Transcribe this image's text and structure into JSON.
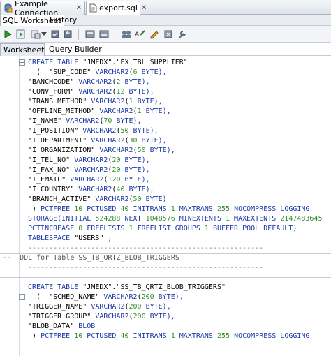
{
  "tabs": [
    {
      "label": "Example Connection",
      "icon": "database-connection-icon"
    },
    {
      "label": "export.sql",
      "icon": "sql-file-icon"
    }
  ],
  "subtabs": {
    "worksheet": "SQL Worksheet",
    "history": "History"
  },
  "worksheet_tabs": {
    "worksheet": "Worksheet",
    "query_builder": "Query Builder"
  },
  "toolbar": [
    "run-statement-icon",
    "run-script-icon",
    "explain-plan-icon",
    "dropdown-arrow-icon",
    "commit-icon",
    "rollback-icon",
    "autotrace-icon",
    "format-icon",
    "uppercase-icon",
    "clear-icon",
    "sql-tuning-icon"
  ],
  "code": {
    "l1": [
      "CREATE TABLE ",
      "\"JMEDX\".\"EX_TBL_SUPPLIER\""
    ],
    "l2": [
      "  (  \"SUP_CODE\" ",
      "VARCHAR2",
      "(",
      "6",
      " BYTE),"
    ],
    "l3": [
      "\"BANCHCODE\" ",
      "VARCHAR2",
      "(",
      "2",
      " BYTE),"
    ],
    "l4": [
      "\"CONV_FORM\" ",
      "VARCHAR2",
      "(",
      "12",
      " BYTE),"
    ],
    "l5": [
      "\"TRANS_METHOD\" ",
      "VARCHAR2",
      "(",
      "1",
      " BYTE),"
    ],
    "l6": [
      "\"OFFLINE_METHOD\" ",
      "VARCHAR2",
      "(",
      "1",
      " BYTE),"
    ],
    "l7": [
      "\"I_NAME\" ",
      "VARCHAR2",
      "(",
      "70",
      " BYTE),"
    ],
    "l8": [
      "\"I_POSITION\" ",
      "VARCHAR2",
      "(",
      "50",
      " BYTE),"
    ],
    "l9": [
      "\"I_DEPARTMENT\" ",
      "VARCHAR2",
      "(",
      "30",
      " BYTE),"
    ],
    "l10": [
      "\"I_ORGANIZATION\" ",
      "VARCHAR2",
      "(",
      "50",
      " BYTE),"
    ],
    "l11": [
      "\"I_TEL_NO\" ",
      "VARCHAR2",
      "(",
      "20",
      " BYTE),"
    ],
    "l12": [
      "\"I_FAX_NO\" ",
      "VARCHAR2",
      "(",
      "20",
      " BYTE),"
    ],
    "l13": [
      "\"I_EMAIL\" ",
      "VARCHAR2",
      "(",
      "120",
      " BYTE),"
    ],
    "l14": [
      "\"I_COUNTRY\" ",
      "VARCHAR2",
      "(",
      "40",
      " BYTE),"
    ],
    "l15": [
      "\"BRANCH_ACTIVE\" ",
      "VARCHAR2",
      "(",
      "50",
      " BYTE)"
    ],
    "l16": [
      " ) ",
      "PCTFREE ",
      "10",
      " PCTUSED ",
      "40",
      " INITRANS ",
      "1",
      " MAXTRANS ",
      "255",
      " NOCOMPRESS LOGGING"
    ],
    "l17": [
      "STORAGE(INITIAL ",
      "524288",
      " NEXT ",
      "1048576",
      " MINEXTENTS ",
      "1",
      " MAXEXTENTS ",
      "2147483645"
    ],
    "l18": [
      "PCTINCREASE ",
      "0",
      " FREELISTS ",
      "1",
      " FREELIST GROUPS ",
      "1",
      " BUFFER_POOL DEFAULT)"
    ],
    "l19": [
      "TABLESPACE ",
      "\"USERS\" ;"
    ],
    "sep1": "--------------------------------------------------------",
    "comment": "--  DDL for Table SS_TB_QRTZ_BLOB_TRIGGERS",
    "sep2": "--------------------------------------------------------",
    "m1": [
      "CREATE TABLE ",
      "\"JMEDX\".\"SS_TB_QRTZ_BLOB_TRIGGERS\""
    ],
    "m2": [
      "  (  \"SCHED_NAME\" ",
      "VARCHAR2",
      "(",
      "200",
      " BYTE),"
    ],
    "m3": [
      "\"TRIGGER_NAME\" ",
      "VARCHAR2",
      "(",
      "200",
      " BYTE),"
    ],
    "m4": [
      "\"TRIGGER_GROUP\" ",
      "VARCHAR2",
      "(",
      "200",
      " BYTE),"
    ],
    "m5": [
      "\"BLOB_DATA\" ",
      "BLOB"
    ],
    "m6": [
      " ) ",
      "PCTFREE ",
      "10",
      " PCTUSED ",
      "40",
      " INITRANS ",
      "1",
      " MAXTRANS ",
      "255",
      " NOCOMPRESS LOGGING"
    ]
  }
}
